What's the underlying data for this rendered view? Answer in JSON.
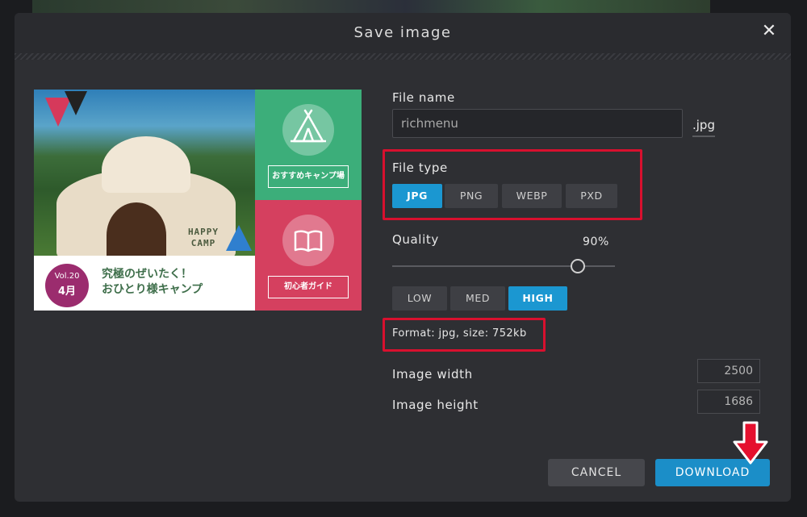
{
  "dialog": {
    "title": "Save image",
    "close_label": "✕"
  },
  "preview": {
    "tent_text_line1": "HAPPY",
    "tent_text_line2": "CAMP",
    "vol": "Vol.20",
    "month": "4月",
    "caption_line1": "究極のぜいたく！",
    "caption_line2": "おひとり様キャンプ",
    "tile_top_label": "おすすめキャンプ場",
    "tile_bottom_label": "初心者ガイド"
  },
  "file_name": {
    "label": "File name",
    "value": "richmenu",
    "extension": ".jpg"
  },
  "file_type": {
    "label": "File type",
    "options": [
      "JPG",
      "PNG",
      "WEBP",
      "PXD"
    ],
    "selected": "JPG"
  },
  "quality": {
    "label": "Quality",
    "value_text": "90%",
    "value": 0.9,
    "presets": [
      "LOW",
      "MED",
      "HIGH"
    ],
    "selected_preset": "HIGH"
  },
  "format_info": "Format: jpg, size: 752kb",
  "image_width": {
    "label": "Image width",
    "value": "2500"
  },
  "image_height": {
    "label": "Image height",
    "value": "1686"
  },
  "buttons": {
    "cancel": "CANCEL",
    "download": "DOWNLOAD"
  },
  "colors": {
    "accent": "#1b97d1",
    "highlight": "#d8102e",
    "tile_green": "#3cae7a",
    "tile_red": "#d5405f"
  }
}
